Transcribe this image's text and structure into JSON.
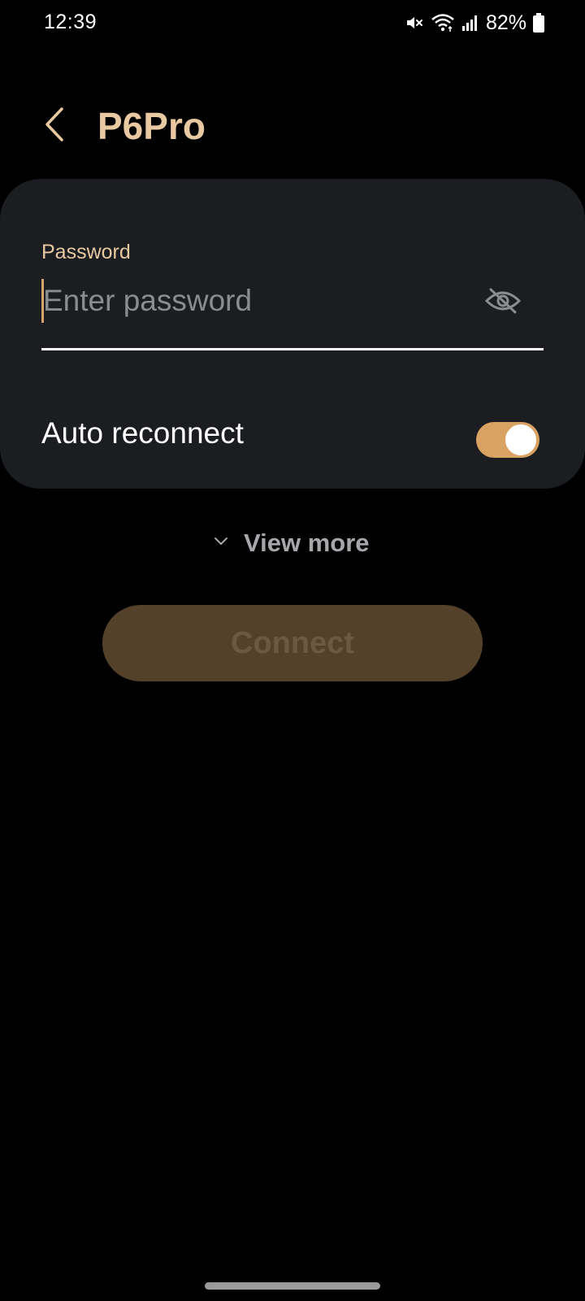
{
  "status_bar": {
    "time": "12:39",
    "battery_percent": "82%",
    "icons": [
      "mute-icon",
      "wifi-icon",
      "signal-icon",
      "battery-icon"
    ]
  },
  "header": {
    "title": "P6Pro",
    "back_icon": "chevron-left-icon"
  },
  "password": {
    "label": "Password",
    "value": "",
    "placeholder": "Enter password",
    "visibility_icon": "eye-off-icon"
  },
  "auto_reconnect": {
    "label": "Auto reconnect",
    "enabled": true
  },
  "view_more": {
    "label": "View more",
    "icon": "chevron-down-icon"
  },
  "connect": {
    "label": "Connect",
    "enabled": false
  },
  "colors": {
    "accent": "#e8c9a2",
    "toggle_on": "#d9a263",
    "card_bg": "#1b1d21",
    "connect_disabled_bg": "#54412a",
    "connect_disabled_text": "#6b5943"
  }
}
